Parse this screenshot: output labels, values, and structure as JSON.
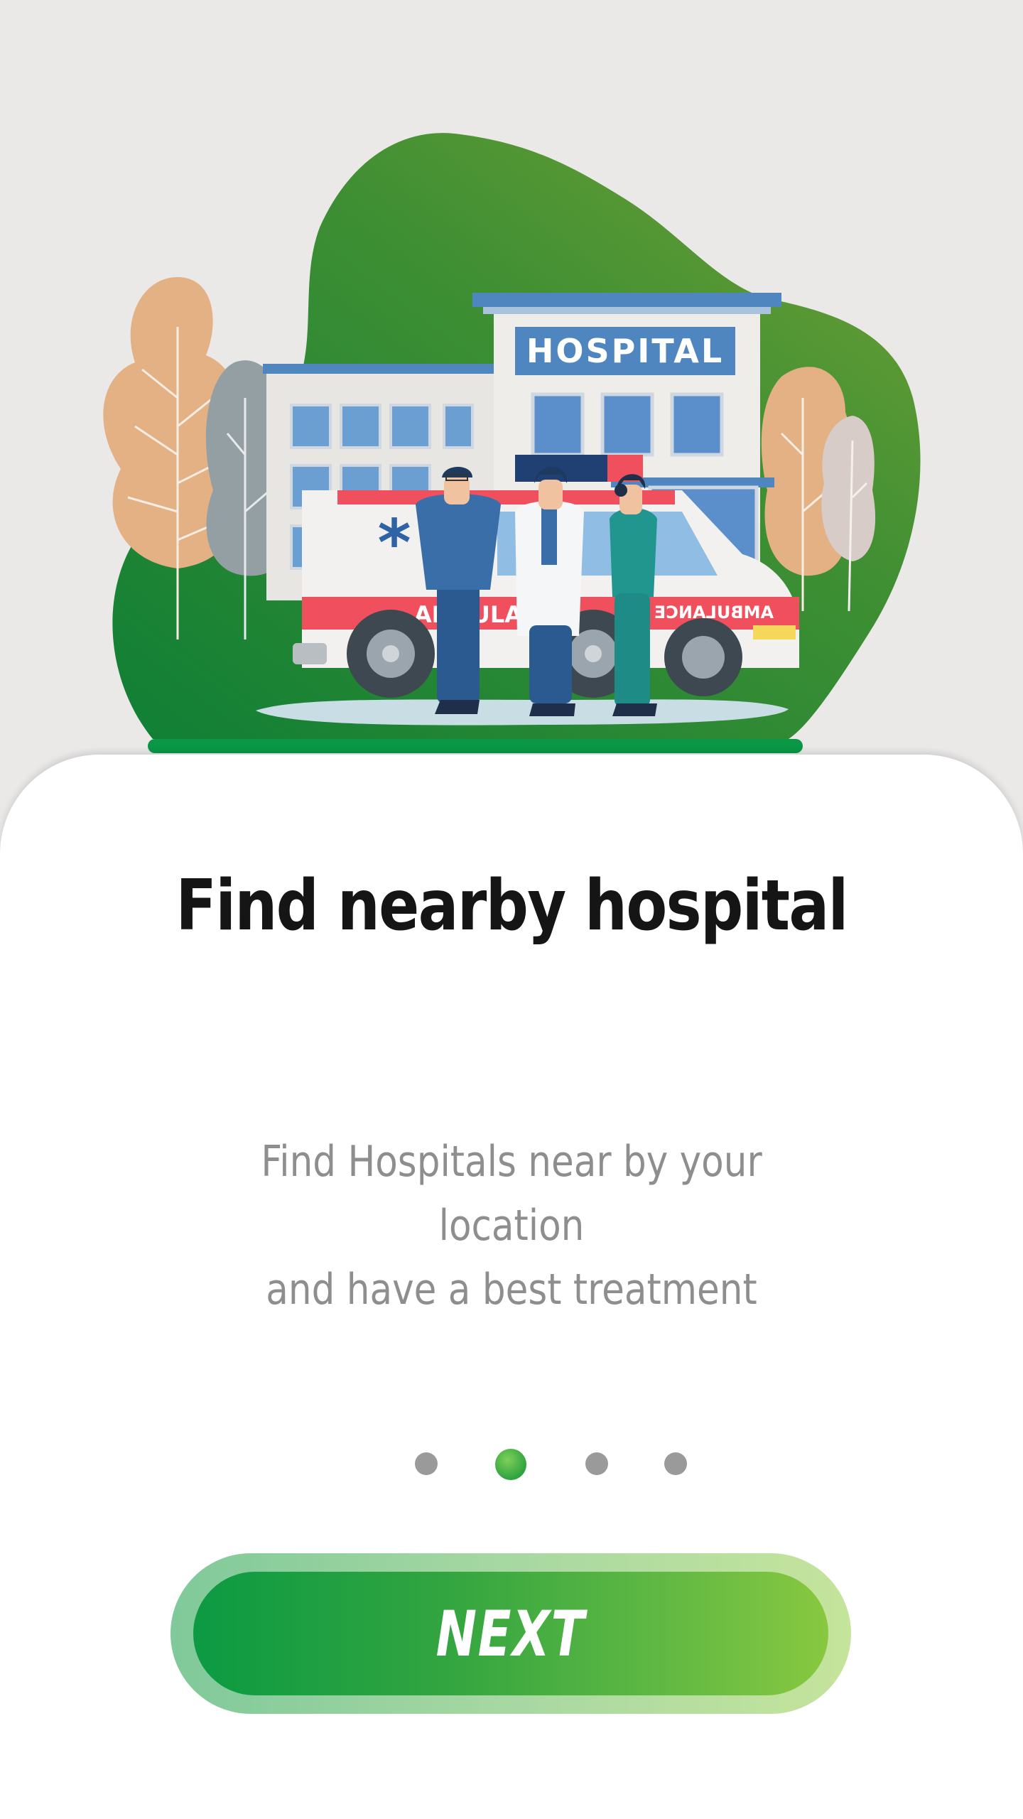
{
  "onboarding": {
    "title": "Find nearby hospital",
    "description_lines": [
      "Find Hospitals near by your location",
      "and have a best treatment"
    ],
    "button_label": "NEXT",
    "pagination": {
      "total": 4,
      "active_index": 1
    }
  },
  "illustration": {
    "sign_text": "HOSPITAL",
    "ambulance_text": "AMBULANCE",
    "ambulance_mirror_text": "AMBULANCE"
  },
  "colors": {
    "accent": "#2fa33f",
    "blob_dark": "#1f8a3a",
    "blob_light": "#6a9f36",
    "title": "#151515",
    "description": "#8e8e8e",
    "inactive_dot": "#9a9a9a"
  }
}
